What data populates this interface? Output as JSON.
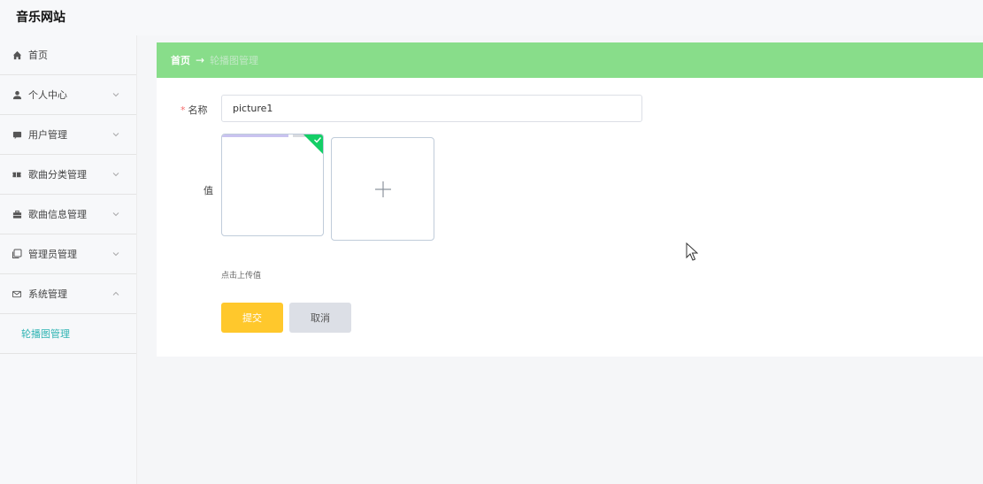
{
  "app": {
    "title": "音乐网站"
  },
  "sidebar": {
    "items": [
      {
        "label": "首页",
        "icon": "home-icon",
        "expandable": false
      },
      {
        "label": "个人中心",
        "icon": "user-icon",
        "expandable": true
      },
      {
        "label": "用户管理",
        "icon": "chat-icon",
        "expandable": true
      },
      {
        "label": "歌曲分类管理",
        "icon": "ticket-icon",
        "expandable": true
      },
      {
        "label": "歌曲信息管理",
        "icon": "briefcase-icon",
        "expandable": true
      },
      {
        "label": "管理员管理",
        "icon": "copy-icon",
        "expandable": true
      },
      {
        "label": "系统管理",
        "icon": "message-icon",
        "expandable": true,
        "expanded": true
      }
    ],
    "submenu": {
      "label": "轮播图管理"
    }
  },
  "breadcrumb": {
    "home": "首页",
    "separator": "→",
    "current": "轮播图管理"
  },
  "form": {
    "name_label": "名称",
    "name_value": "picture1",
    "value_label": "值",
    "upload_tip": "点击上传值",
    "submit_label": "提交",
    "cancel_label": "取消"
  },
  "colors": {
    "breadcrumb_bg": "#88dd8a",
    "accent": "#2eb3b3",
    "submit": "#ffc82c",
    "success": "#13ce66"
  }
}
